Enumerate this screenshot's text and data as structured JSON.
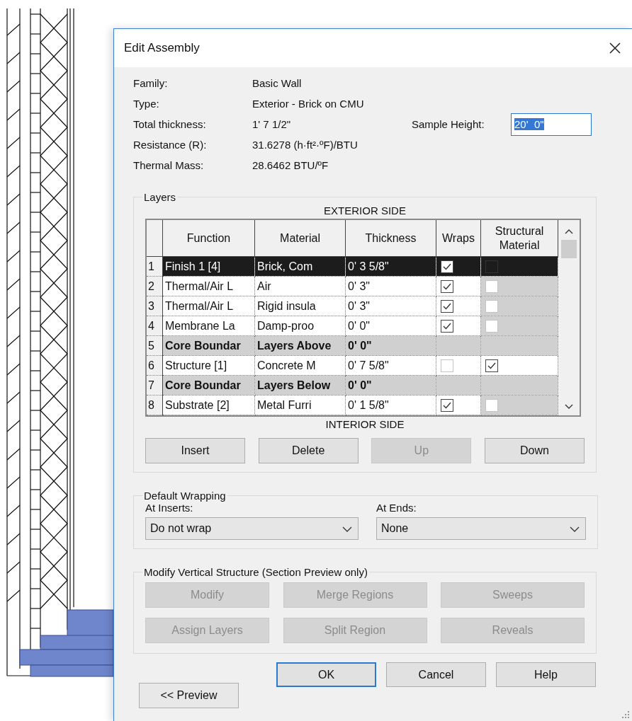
{
  "window": {
    "title": "Edit Assembly"
  },
  "info": [
    {
      "label": "Family:",
      "value": "Basic Wall"
    },
    {
      "label": "Type:",
      "value": "Exterior - Brick on CMU"
    },
    {
      "label": "Total thickness:",
      "value": "1'  7 1/2\""
    },
    {
      "label": "Resistance (R):",
      "value": "31.6278 (h·ft²·ºF)/BTU"
    },
    {
      "label": "Thermal Mass:",
      "value": "28.6462 BTU/ºF"
    }
  ],
  "sample_height": {
    "label": "Sample Height:",
    "value": "20'  0\""
  },
  "layers": {
    "title": "Layers",
    "top_label": "EXTERIOR SIDE",
    "bottom_label": "INTERIOR SIDE",
    "columns": [
      "Function",
      "Material",
      "Thickness",
      "Wraps",
      "Structural Material"
    ],
    "rows": [
      {
        "number": "1",
        "function": "Finish 1 [4]",
        "material": "Brick, Com",
        "thickness": "0'  3 5/8\"",
        "kind": "layer",
        "selected": true,
        "wraps": true,
        "structural": false,
        "structural_disabled": true
      },
      {
        "number": "2",
        "function": "Thermal/Air L",
        "material": "Air",
        "thickness": "0'  3\"",
        "kind": "layer",
        "selected": false,
        "wraps": true,
        "structural": false,
        "structural_disabled": true
      },
      {
        "number": "3",
        "function": "Thermal/Air L",
        "material": "Rigid insula",
        "thickness": "0'  3\"",
        "kind": "layer",
        "selected": false,
        "wraps": true,
        "structural": false,
        "structural_disabled": true
      },
      {
        "number": "4",
        "function": "Membrane La",
        "material": "Damp-proo",
        "thickness": "0'  0\"",
        "kind": "layer",
        "selected": false,
        "wraps": true,
        "structural": false,
        "structural_disabled": true
      },
      {
        "number": "5",
        "function": "Core Boundar",
        "material": "Layers Above",
        "thickness": "0'  0\"",
        "kind": "boundary",
        "selected": false
      },
      {
        "number": "6",
        "function": "Structure [1]",
        "material": "Concrete M",
        "thickness": "0'  7 5/8\"",
        "kind": "layer",
        "selected": false,
        "wraps": false,
        "structural": true,
        "structural_disabled": false
      },
      {
        "number": "7",
        "function": "Core Boundar",
        "material": "Layers Below",
        "thickness": "0'  0\"",
        "kind": "boundary",
        "selected": false
      },
      {
        "number": "8",
        "function": "Substrate [2]",
        "material": "Metal Furri",
        "thickness": "0'  1 5/8\"",
        "kind": "layer",
        "selected": false,
        "wraps": true,
        "structural": false,
        "structural_disabled": true
      }
    ],
    "buttons": [
      {
        "label": "Insert",
        "disabled": false
      },
      {
        "label": "Delete",
        "disabled": false
      },
      {
        "label": "Up",
        "disabled": true
      },
      {
        "label": "Down",
        "disabled": false
      }
    ]
  },
  "default_wrapping": {
    "title": "Default Wrapping",
    "at_inserts": {
      "label": "At Inserts:",
      "value": "Do not wrap"
    },
    "at_ends": {
      "label": "At Ends:",
      "value": "None"
    }
  },
  "vertical_structure": {
    "title": "Modify Vertical Structure (Section Preview only)",
    "buttons": [
      {
        "label": "Modify",
        "disabled": true
      },
      {
        "label": "Merge Regions",
        "disabled": true
      },
      {
        "label": "Sweeps",
        "disabled": true
      },
      {
        "label": "Assign Layers",
        "disabled": true
      },
      {
        "label": "Split Region",
        "disabled": true
      },
      {
        "label": "Reveals",
        "disabled": true
      }
    ]
  },
  "footer_buttons": [
    {
      "label": "OK",
      "default": true
    },
    {
      "label": "Cancel",
      "default": false
    },
    {
      "label": "Help",
      "default": false
    }
  ],
  "preview_button": "<< Preview"
}
